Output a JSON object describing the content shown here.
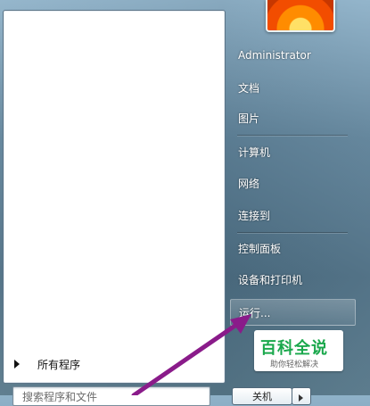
{
  "left_pane": {
    "all_programs_label": "所有程序",
    "search_placeholder": "搜索程序和文件"
  },
  "right_pane": {
    "user_name": "Administrator",
    "items": [
      {
        "label": "文档"
      },
      {
        "label": "图片"
      },
      {
        "label": "计算机"
      },
      {
        "label": "网络"
      },
      {
        "label": "连接到"
      },
      {
        "label": "控制面板"
      },
      {
        "label": "设备和打印机"
      },
      {
        "label": "运行..."
      }
    ],
    "shutdown_label": "关机"
  },
  "watermark": {
    "title": "百科全说",
    "subtitle": "助你轻松解决"
  },
  "annotation": {
    "arrow_color": "#8a1b8a"
  }
}
